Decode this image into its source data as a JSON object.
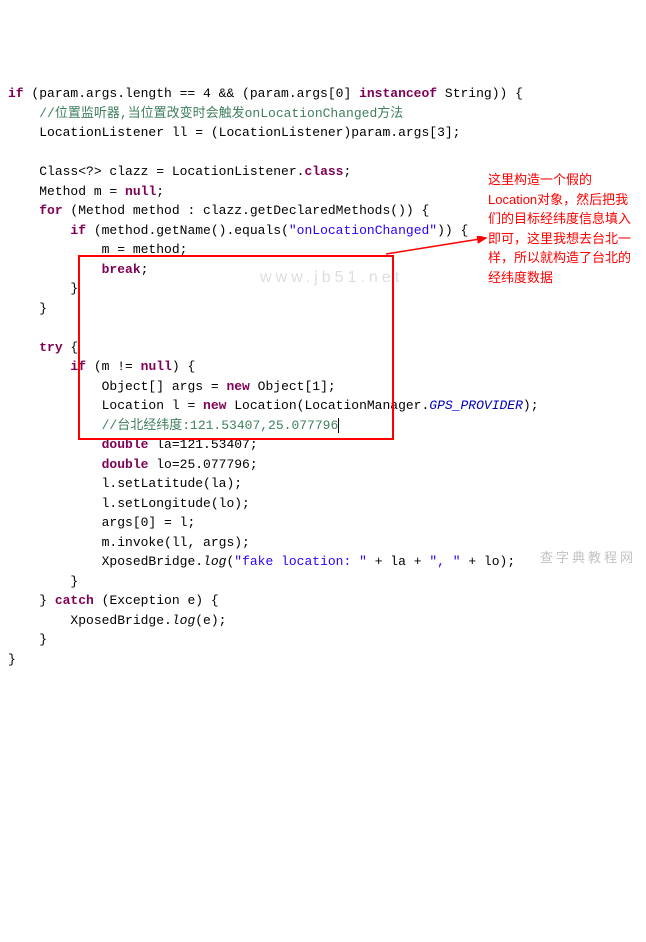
{
  "code": {
    "l1": {
      "a": "if",
      "b": " (param.args.length == 4 && (param.args[0] ",
      "c": "instanceof",
      "d": " String)) {"
    },
    "l2": "//位置监听器,当位置改变时会触发onLocationChanged方法",
    "l3": "LocationListener ll = (LocationListener)param.args[3];",
    "l5": "Class<?> clazz = LocationListener.",
    "l5b": "class",
    "l5c": ";",
    "l6a": "Method m = ",
    "l6b": "null",
    "l6c": ";",
    "l7a": "for",
    "l7b": " (Method method : clazz.getDeclaredMethods()) {",
    "l8a": "if",
    "l8b": " (method.getName().equals(",
    "l8c": "\"onLocationChanged\"",
    "l8d": ")) {",
    "l9": "m = method;",
    "l10a": "break",
    "l10b": ";",
    "l11": "}",
    "l12": "}",
    "l14a": "try",
    "l14b": " {",
    "l15a": "if",
    "l15b": " (m != ",
    "l15c": "null",
    "l15d": ") {",
    "l16a": "Object[] args = ",
    "l16b": "new",
    "l16c": " Object[1];",
    "l17a": "Location l = ",
    "l17b": "new",
    "l17c": " Location(LocationManager.",
    "l17d": "GPS_PROVIDER",
    "l17e": ");",
    "l18": "//台北经纬度:121.53407,25.077796",
    "l19a": "double",
    "l19b": " la=121.53407;",
    "l20a": "double",
    "l20b": " lo=25.077796;",
    "l21": "l.setLatitude(la);",
    "l22": "l.setLongitude(lo);",
    "l23": "args[0] = l;",
    "l24": "m.invoke(ll, args);",
    "l25a": "XposedBridge.",
    "l25b": "log",
    "l25c": "(",
    "l25d": "\"fake location: \"",
    "l25e": " + la + ",
    "l25f": "\", \"",
    "l25g": " + lo);",
    "l26": "}",
    "l27a": "} ",
    "l27b": "catch",
    "l27c": " (Exception e) {",
    "l28a": "XposedBridge.",
    "l28b": "log",
    "l28c": "(e);",
    "l29": "}",
    "l30": "}"
  },
  "annotation": "这里构造一个假的Location对象，然后把我们的目标经纬度信息填入即可，这里我想去台北一样，所以就构造了台北的经纬度数据",
  "watermark1": "www.jb51.net",
  "watermark2": "查字典教程网"
}
